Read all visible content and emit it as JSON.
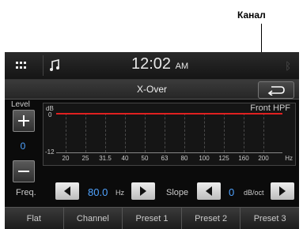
{
  "callout": {
    "label": "Канал"
  },
  "status": {
    "time": "12:02",
    "ampm": "AM"
  },
  "header": {
    "title": "X-Over"
  },
  "level": {
    "label": "Level",
    "value": "0"
  },
  "graph": {
    "y_unit": "dB",
    "y_top": "0",
    "y_bottom": "-12",
    "channel": "Front HPF",
    "freq_ticks": [
      "20",
      "25",
      "31.5",
      "40",
      "50",
      "63",
      "80",
      "100",
      "125",
      "160",
      "200"
    ],
    "x_unit": "Hz"
  },
  "controls": {
    "freq_label": "Freq.",
    "freq_value": "80.0",
    "freq_unit": "Hz",
    "slope_label": "Slope",
    "slope_value": "0",
    "slope_unit": "dB/oct"
  },
  "tabs": [
    "Flat",
    "Channel",
    "Preset 1",
    "Preset 2",
    "Preset 3"
  ]
}
